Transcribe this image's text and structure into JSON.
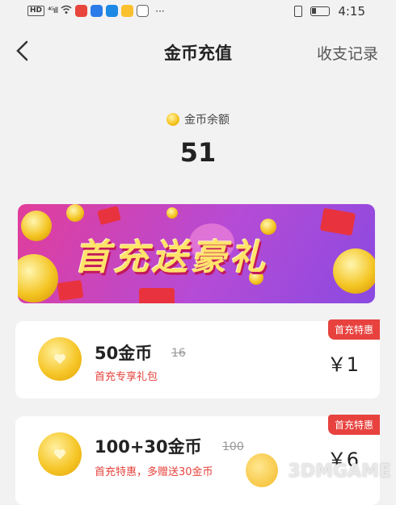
{
  "status_bar": {
    "hd": "HD",
    "signal": "⁴ᴳıll",
    "dots": "···",
    "time": "4:15"
  },
  "header": {
    "title": "金币充值",
    "records": "收支记录"
  },
  "balance": {
    "label": "金币余额",
    "value": "51"
  },
  "banner": {
    "text": "首充送豪礼"
  },
  "packages": [
    {
      "badge": "首充特惠",
      "name": "50金币",
      "original": "16",
      "subtitle": "首充专享礼包",
      "price": "￥1"
    },
    {
      "badge": "首充特惠",
      "name": "100+30金币",
      "original": "100",
      "subtitle": "首充特惠，多赠送30金币",
      "price": "￥6"
    }
  ],
  "watermark": "3DMGAME",
  "colors": {
    "accent_red": "#e7423e",
    "gold": "#f5c21a",
    "banner_pink": "#e23d9a",
    "banner_purple": "#8a4ae0"
  }
}
